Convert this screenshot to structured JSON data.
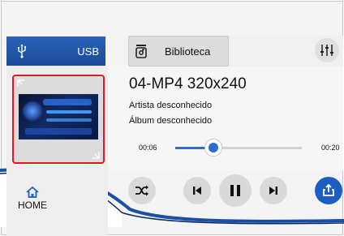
{
  "source": {
    "label": "USB",
    "icon": "usb-icon"
  },
  "library": {
    "label": "Biblioteca",
    "icon": "library-icon"
  },
  "equalizer": {
    "icon": "equalizer-icon"
  },
  "track": {
    "title": "04-MP4 320x240",
    "artist": "Artista desconhecido",
    "album": "Álbum desconhecido"
  },
  "progress": {
    "elapsed": "00:06",
    "total": "00:20",
    "fraction": 0.3
  },
  "controls": {
    "shuffle_icon": "shuffle-icon",
    "previous_icon": "previous-track-icon",
    "pause_icon": "pause-icon",
    "next_icon": "next-track-icon",
    "share_icon": "share-icon"
  },
  "home": {
    "label": "HOME",
    "icon": "home-icon"
  },
  "colors": {
    "accent": "#1d5ec4",
    "highlight_border": "#e01a22"
  }
}
